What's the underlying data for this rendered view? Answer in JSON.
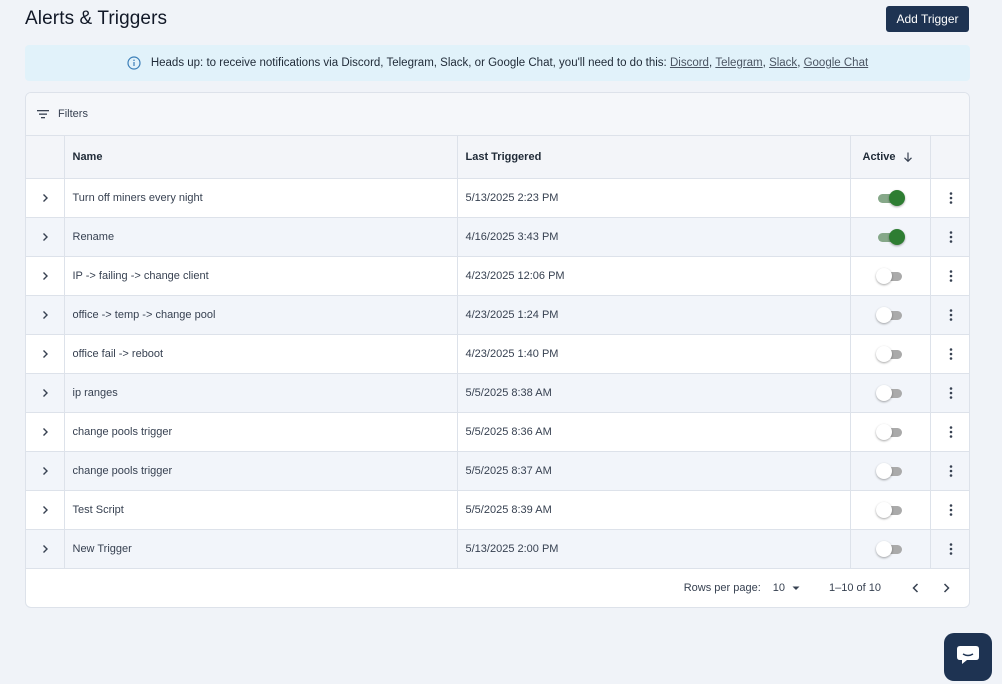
{
  "page": {
    "title": "Alerts & Triggers",
    "add_button": "Add Trigger"
  },
  "banner": {
    "text": "Heads up: to receive notifications via Discord, Telegram, Slack, or Google Chat, you'll need to do this:",
    "links": [
      "Discord",
      "Telegram",
      "Slack",
      "Google Chat"
    ],
    "separator": ","
  },
  "filters": {
    "label": "Filters"
  },
  "table": {
    "columns": {
      "name": "Name",
      "last_triggered": "Last Triggered",
      "active": "Active"
    },
    "rows": [
      {
        "name": "Turn off miners every night",
        "last_triggered": "5/13/2025 2:23 PM",
        "active": true
      },
      {
        "name": "Rename",
        "last_triggered": "4/16/2025 3:43 PM",
        "active": true
      },
      {
        "name": "IP -> failing -> change client",
        "last_triggered": "4/23/2025 12:06 PM",
        "active": false
      },
      {
        "name": "office -> temp -> change pool",
        "last_triggered": "4/23/2025 1:24 PM",
        "active": false
      },
      {
        "name": "office fail -> reboot",
        "last_triggered": "4/23/2025 1:40 PM",
        "active": false
      },
      {
        "name": "ip ranges",
        "last_triggered": "5/5/2025 8:38 AM",
        "active": false
      },
      {
        "name": "change pools trigger",
        "last_triggered": "5/5/2025 8:36 AM",
        "active": false
      },
      {
        "name": "change pools trigger",
        "last_triggered": "5/5/2025 8:37 AM",
        "active": false
      },
      {
        "name": "Test Script",
        "last_triggered": "5/5/2025 8:39 AM",
        "active": false
      },
      {
        "name": "New Trigger",
        "last_triggered": "5/13/2025 2:00 PM",
        "active": false
      }
    ]
  },
  "pagination": {
    "rows_per_page_label": "Rows per page:",
    "rows_per_page_value": "10",
    "range": "1–10 of 10"
  },
  "colors": {
    "primary": "#1e3352",
    "toggle_on": "#2e7d32",
    "banner_bg": "#e1f2fa"
  },
  "icons": [
    "info-icon",
    "filter-icon",
    "chevron-right-icon",
    "sort-arrow-down-icon",
    "kebab-menu-icon",
    "caret-down-icon",
    "chevron-left-icon",
    "chat-icon"
  ]
}
